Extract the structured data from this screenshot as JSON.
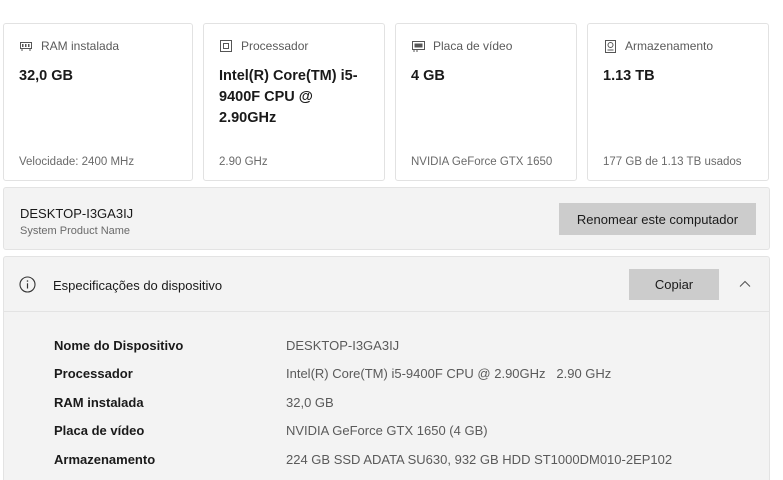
{
  "cards": [
    {
      "title": "RAM instalada",
      "icon": "ram-icon",
      "value": "32,0 GB",
      "sub": "Velocidade: 2400 MHz"
    },
    {
      "title": "Processador",
      "icon": "processor-icon",
      "value": "Intel(R) Core(TM) i5-9400F CPU @ 2.90GHz",
      "sub": "2.90 GHz"
    },
    {
      "title": "Placa de vídeo",
      "icon": "gpu-icon",
      "value": "4 GB",
      "sub": "NVIDIA GeForce GTX 1650"
    },
    {
      "title": "Armazenamento",
      "icon": "storage-icon",
      "value": "1.13 TB",
      "sub": "177 GB de 1.13 TB usados"
    }
  ],
  "device": {
    "name": "DESKTOP-I3GA3IJ",
    "model": "System Product Name",
    "rename_label": "Renomear este computador"
  },
  "specs": {
    "title": "Especificações do dispositivo",
    "copy_label": "Copiar",
    "rows": [
      {
        "label": "Nome do Dispositivo",
        "value": "DESKTOP-I3GA3IJ"
      },
      {
        "label": "Processador",
        "value": "Intel(R) Core(TM) i5-9400F CPU @ 2.90GHz   2.90 GHz"
      },
      {
        "label": "RAM instalada",
        "value": "32,0 GB"
      },
      {
        "label": "Placa de vídeo",
        "value": "NVIDIA GeForce GTX 1650 (4 GB)"
      },
      {
        "label": "Armazenamento",
        "value": "224 GB SSD ADATA SU630, 932 GB HDD ST1000DM010-2EP102"
      }
    ]
  },
  "colors": {
    "panel_bg": "#f3f3f3",
    "button_bg": "#cccccc",
    "card_border": "#e2e2e2"
  }
}
